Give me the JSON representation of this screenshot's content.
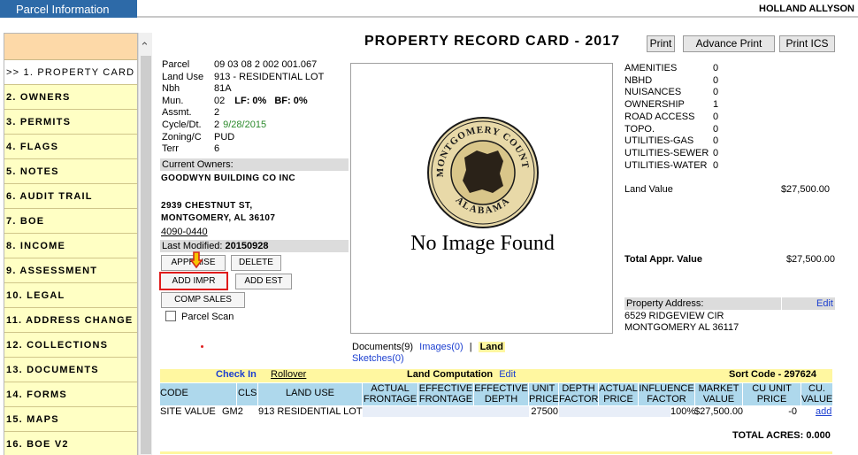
{
  "topbar": {
    "panel_title": "Parcel Information",
    "user_name": "HOLLAND ALLYSON"
  },
  "sidebar": {
    "items": [
      {
        "label": ">> 1. PROPERTY CARD",
        "active": true
      },
      {
        "label": "2. OWNERS"
      },
      {
        "label": "3. PERMITS"
      },
      {
        "label": "4. FLAGS"
      },
      {
        "label": "5. NOTES"
      },
      {
        "label": "6. AUDIT TRAIL"
      },
      {
        "label": "7. BOE"
      },
      {
        "label": "8. INCOME"
      },
      {
        "label": "9. ASSESSMENT"
      },
      {
        "label": "10. LEGAL"
      },
      {
        "label": "11. ADDRESS CHANGE"
      },
      {
        "label": "12. COLLECTIONS"
      },
      {
        "label": "13. DOCUMENTS"
      },
      {
        "label": "14. FORMS"
      },
      {
        "label": "15. MAPS"
      },
      {
        "label": "16. BOE V2"
      }
    ]
  },
  "header": {
    "title": "PROPERTY RECORD CARD - 2017",
    "print_label": "Print",
    "advance_print_label": "Advance Print",
    "print_ics_label": "Print ICS"
  },
  "parcel": {
    "rows": [
      {
        "label": "Parcel",
        "value": "09 03 08 2 002 001.067"
      },
      {
        "label": "Land Use",
        "value": "913 - RESIDENTIAL LOT"
      },
      {
        "label": "Nbh",
        "value": "81A"
      },
      {
        "label": "Mun.",
        "value": "02"
      },
      {
        "label": "Assmt.",
        "value": "2"
      },
      {
        "label": "Cycle/Dt.",
        "value": "2"
      },
      {
        "label": "Zoning/C",
        "value": "PUD"
      },
      {
        "label": "Terr",
        "value": "6"
      }
    ],
    "lf_label": "LF: 0%",
    "bf_label": "BF: 0%",
    "cycle_date": "9/28/2015"
  },
  "owners": {
    "header": "Current Owners:",
    "name": "GOODWYN BUILDING CO INC",
    "address1": "2939 CHESTNUT ST,",
    "address2": "MONTGOMERY, AL  36107",
    "phone": "4090-0440"
  },
  "last_modified": {
    "label": "Last Modified:",
    "value": "20150928"
  },
  "buttons": {
    "appraise": "APPRAISE",
    "delete": "DELETE",
    "add_impr": "ADD IMPR",
    "add_est": "ADD EST",
    "comp_sales": "COMP SALES",
    "parcel_scan": "Parcel Scan"
  },
  "image": {
    "seal_text_top": "MONTGOMERY COUNTY",
    "seal_text_bottom": "ALABAMA",
    "no_image": "No Image Found"
  },
  "attributes": [
    {
      "label": "AMENITIES",
      "value": "0"
    },
    {
      "label": "NBHD",
      "value": "0"
    },
    {
      "label": "NUISANCES",
      "value": "0"
    },
    {
      "label": "OWNERSHIP",
      "value": "1"
    },
    {
      "label": "ROAD ACCESS",
      "value": "0"
    },
    {
      "label": "TOPO.",
      "value": "0"
    },
    {
      "label": "UTILITIES-GAS",
      "value": "0"
    },
    {
      "label": "UTILITIES-SEWER",
      "value": "0"
    },
    {
      "label": "UTILITIES-WATER",
      "value": "0"
    }
  ],
  "values": {
    "land_value_label": "Land Value",
    "land_value": "$27,500.00",
    "total_appr_label": "Total Appr. Value",
    "total_appr": "$27,500.00"
  },
  "property_address": {
    "label": "Property Address:",
    "edit": "Edit",
    "line1": "6529 RIDGEVIEW CIR",
    "line2": "MONTGOMERY AL 36117"
  },
  "doc_links": {
    "documents": "Documents(9)",
    "images": "Images(0)",
    "separator": "|",
    "land": "Land",
    "sketches": "Sketches(0)"
  },
  "land_table": {
    "check_in": "Check In",
    "rollover": "Rollover",
    "computation": "Land Computation",
    "edit": "Edit",
    "sort_code": "Sort Code - 297624",
    "headers": [
      "CODE",
      "CLS",
      "LAND USE",
      "ACTUAL FRONTAGE",
      "EFFECTIVE FRONTAGE",
      "EFFECTIVE DEPTH",
      "UNIT PRICE",
      "DEPTH FACTOR",
      "ACTUAL PRICE",
      "INFLUENCE FACTOR",
      "MARKET VALUE",
      "CU UNIT PRICE",
      "CU. VALUE"
    ],
    "row": {
      "code": "SITE VALUE",
      "cls": "GM2",
      "land_use": "913 RESIDENTIAL LOT",
      "unit_price": "27500",
      "influence": "100%",
      "market_value": "$27,500.00",
      "cu_unit_price": "-0",
      "cu_value": "add"
    },
    "total_acres": "TOTAL ACRES: 0.000"
  }
}
